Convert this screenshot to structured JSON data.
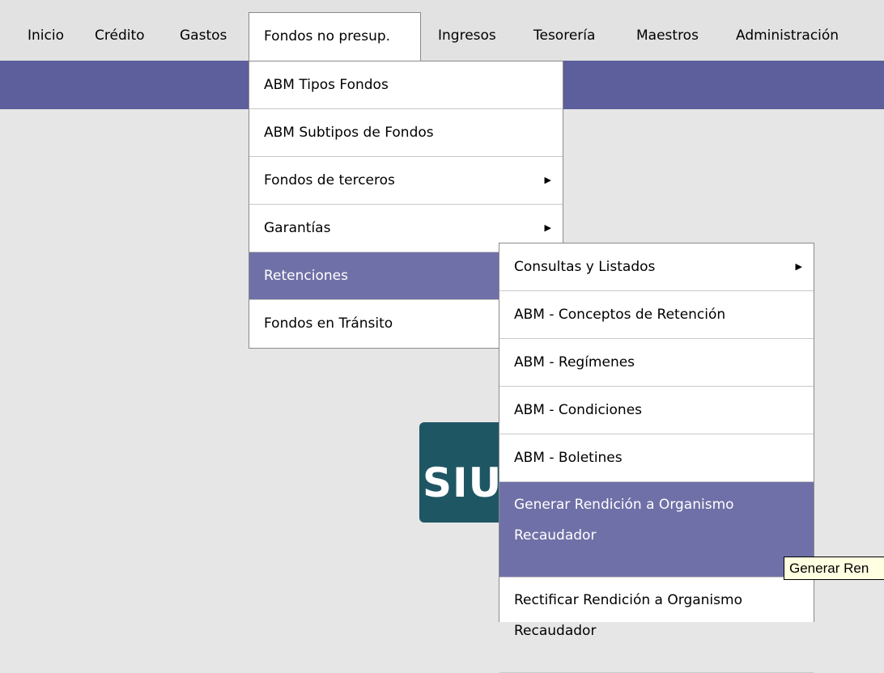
{
  "menubar": {
    "items": [
      {
        "label": "Inicio"
      },
      {
        "label": "Crédito"
      },
      {
        "label": "Gastos"
      },
      {
        "label": "Fondos no presup."
      },
      {
        "label": "Ingresos"
      },
      {
        "label": "Tesorería"
      },
      {
        "label": "Maestros"
      },
      {
        "label": "Administración"
      }
    ]
  },
  "main_menu": {
    "items": [
      {
        "label": "ABM Tipos Fondos"
      },
      {
        "label": "ABM Subtipos de Fondos"
      },
      {
        "label": "Fondos de terceros",
        "has_submenu": true
      },
      {
        "label": "Garantías",
        "has_submenu": true
      },
      {
        "label": "Retenciones",
        "selected": true
      },
      {
        "label": "Fondos en Tránsito"
      }
    ]
  },
  "sub_menu": {
    "items": [
      {
        "label": "Consultas y Listados",
        "has_submenu": true
      },
      {
        "label": "ABM - Conceptos de Retención"
      },
      {
        "label": "ABM - Regímenes"
      },
      {
        "label": "ABM - Condiciones"
      },
      {
        "label": "ABM - Boletines"
      },
      {
        "label": "Generar Rendición a Organismo Recaudador",
        "selected": true
      },
      {
        "label": "Rectificar Rendición a Organismo Recaudador"
      }
    ]
  },
  "logo": {
    "text": "SIU"
  },
  "tooltip": {
    "text": "Generar Ren"
  },
  "colors": {
    "band": "#5d5e9c",
    "selected": "#7070a8",
    "logo_bg": "#1f5664",
    "tooltip_bg": "#ffffe1"
  },
  "icons": {
    "submenu_arrow": "triangle-right-icon"
  }
}
